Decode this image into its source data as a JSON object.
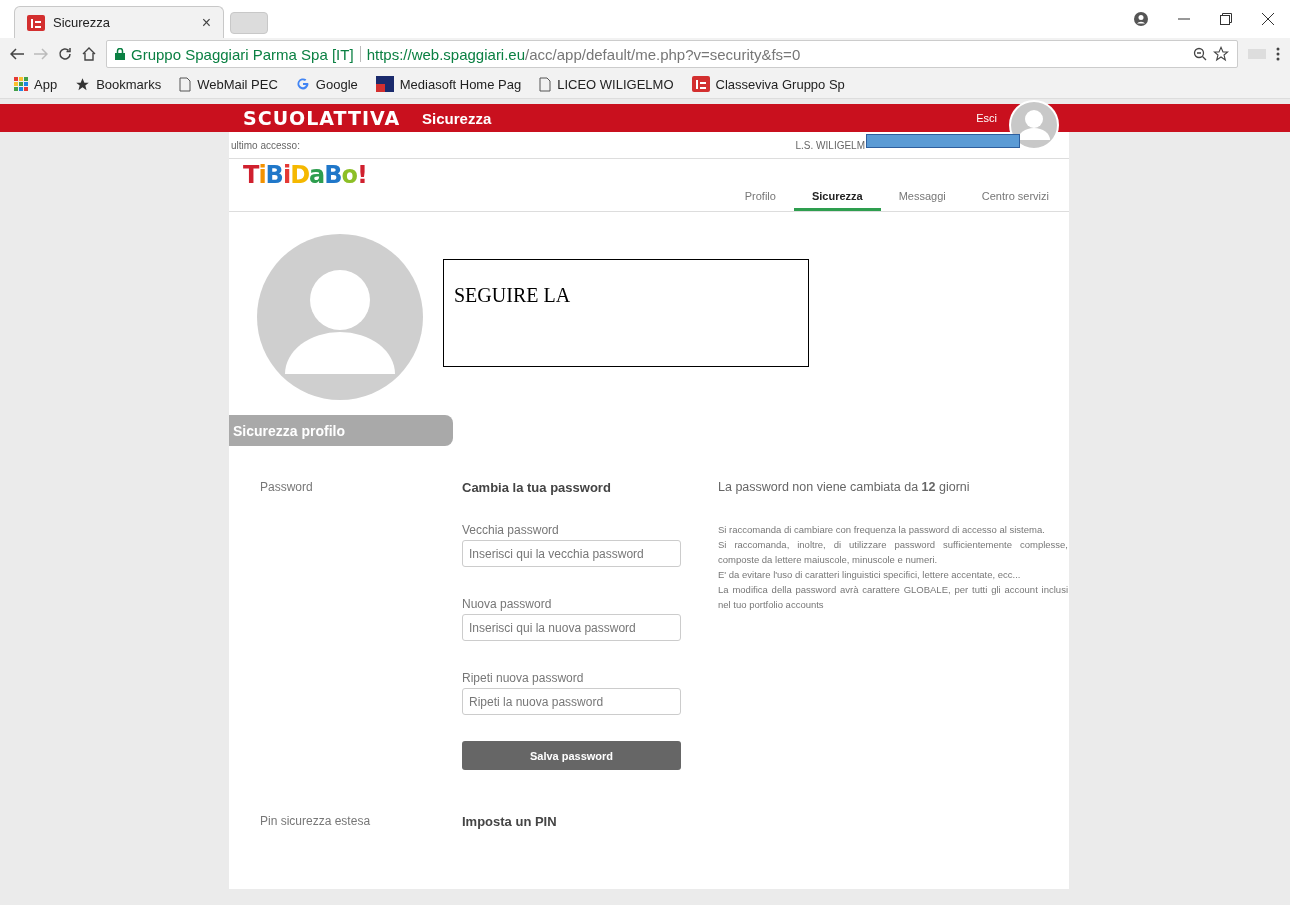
{
  "browser": {
    "tabs": [
      {
        "title": "Sicurezza",
        "close": "×",
        "selected": true
      }
    ],
    "address": {
      "site": "Gruppo Spaggiari Parma Spa [IT]",
      "url_host": "https://web.spaggiari.eu",
      "url_path": "/acc/app/default/me.php?v=security&fs=0"
    },
    "bookmarks": [
      {
        "kind": "apps",
        "label": "App"
      },
      {
        "kind": "star",
        "label": "Bookmarks"
      },
      {
        "kind": "page",
        "label": "WebMail PEC"
      },
      {
        "kind": "google",
        "label": "Google"
      },
      {
        "kind": "mediasoft",
        "label": "Mediasoft Home Pag"
      },
      {
        "kind": "page",
        "label": "LICEO WILIGELMO"
      },
      {
        "kind": "is",
        "label": "Classeviva Gruppo Sp"
      }
    ]
  },
  "header": {
    "brand": "SCUOLATTIVA",
    "page_title": "Sicurezza",
    "logout": "Esci"
  },
  "subbar": {
    "last_access": "ultimo accesso:",
    "school": "L.S. WILIGELM"
  },
  "logo": "TiBiDaBo!",
  "nav": [
    {
      "label": "Profilo",
      "selected": false
    },
    {
      "label": "Sicurezza",
      "selected": true
    },
    {
      "label": "Messaggi",
      "selected": false
    },
    {
      "label": "Centro servizi",
      "selected": false
    }
  ],
  "annotation": "SEGUIRE LA",
  "section_title": "Sicurezza profilo",
  "password": {
    "label": "Password",
    "title": "Cambia la tua password",
    "fields": [
      {
        "label": "Vecchia password",
        "placeholder": "Inserisci qui la vecchia password"
      },
      {
        "label": "Nuova password",
        "placeholder": "Inserisci qui la nuova password"
      },
      {
        "label": "Ripeti nuova password",
        "placeholder": "Ripeti la nuova password"
      }
    ],
    "button": "Salva password",
    "status": "La password non viene cambiata da **12** giorni",
    "advice": [
      "Si raccomanda di cambiare con frequenza la password di accesso al sistema.",
      "Si raccomanda, inoltre, di utilizzare password sufficientemente complesse, composte da lettere maiuscole, minuscole e numeri.",
      "E' da evitare l'uso di caratteri linguistici specifici, lettere accentate, ecc...",
      "La modifica della password avrà carattere GLOBALE, per tutti gli account inclusi nel tuo portfolio accounts"
    ]
  },
  "pin": {
    "label": "Pin sicurezza estesa",
    "title": "Imposta un PIN"
  }
}
